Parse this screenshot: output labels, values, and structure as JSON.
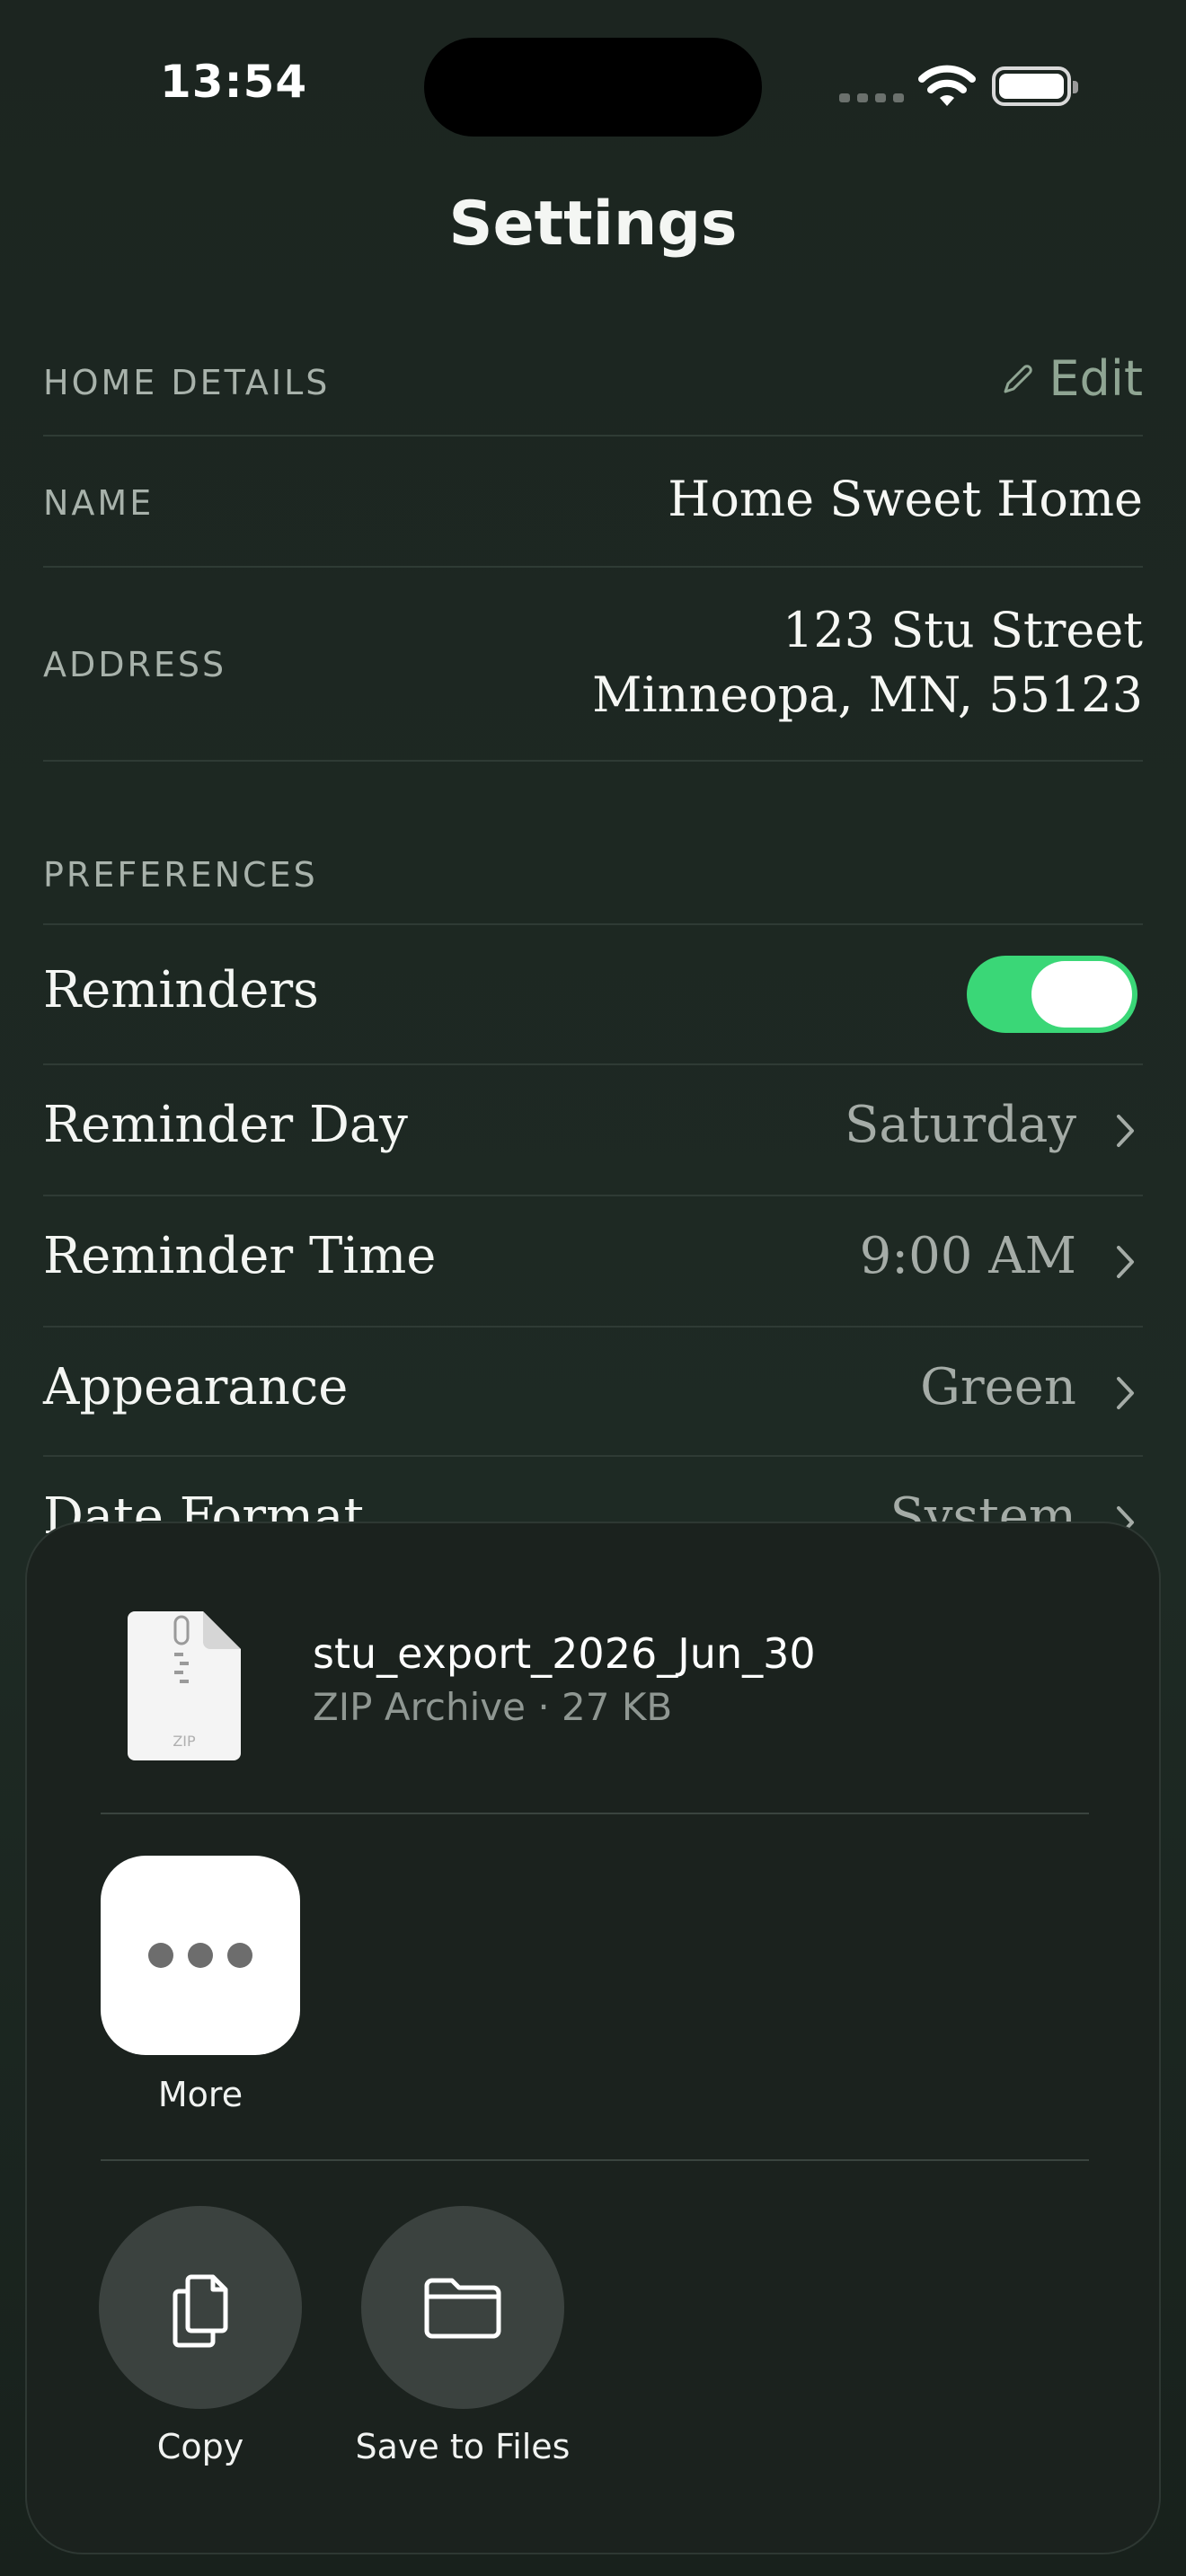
{
  "status_bar": {
    "time": "13:54"
  },
  "header": {
    "title": "Settings"
  },
  "home_details": {
    "section_title": "HOME DETAILS",
    "edit_label": "Edit",
    "name_label": "NAME",
    "name_value": "Home Sweet Home",
    "address_label": "ADDRESS",
    "address_line1": "123 Stu Street",
    "address_line2": "Minneopa, MN, 55123"
  },
  "preferences": {
    "section_title": "PREFERENCES",
    "reminders_label": "Reminders",
    "reminders_on": true,
    "rows": [
      {
        "label": "Reminder Day",
        "value": "Saturday"
      },
      {
        "label": "Reminder Time",
        "value": "9:00 AM"
      },
      {
        "label": "Appearance",
        "value": "Green"
      },
      {
        "label": "Date Format",
        "value": "System"
      }
    ]
  },
  "share_sheet": {
    "file_name": "stu_export_2026_Jun_30",
    "file_meta": "ZIP Archive · 27 KB",
    "file_badge": "ZIP",
    "apps": [
      {
        "label": "More",
        "icon": "more-icon"
      }
    ],
    "actions": [
      {
        "label": "Copy",
        "icon": "copy-icon"
      },
      {
        "label": "Save to Files",
        "icon": "folder-icon"
      }
    ]
  },
  "colors": {
    "toggle_on": "#3ad777",
    "accent_edit": "#8fa593",
    "background": "#1e2a24"
  }
}
